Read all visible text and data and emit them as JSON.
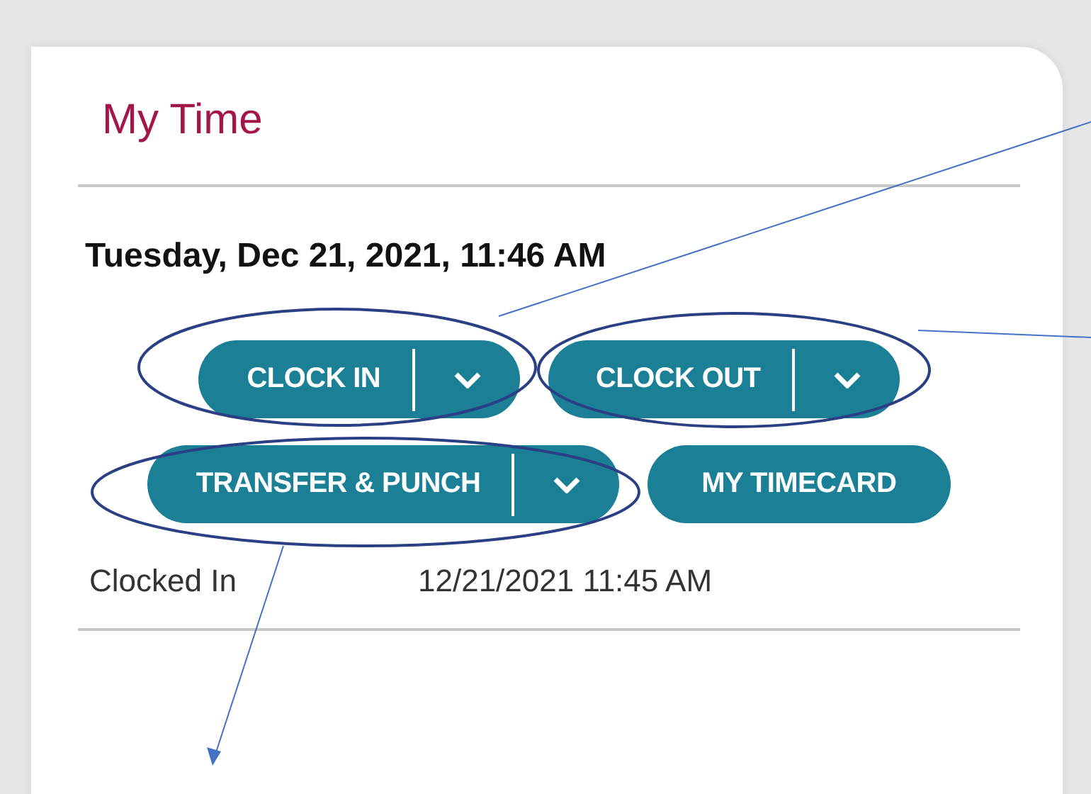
{
  "card": {
    "title": "My Time",
    "datetime": "Tuesday, Dec 21, 2021, 11:46 AM"
  },
  "buttons": [
    {
      "label": "CLOCK IN",
      "kind": "split"
    },
    {
      "label": "CLOCK OUT",
      "kind": "split"
    },
    {
      "label": "TRANSFER & PUNCH",
      "kind": "split"
    },
    {
      "label": "MY TIMECARD",
      "kind": "plain"
    }
  ],
  "status": {
    "label": "Clocked In",
    "value": "12/21/2021 11:45 AM"
  }
}
